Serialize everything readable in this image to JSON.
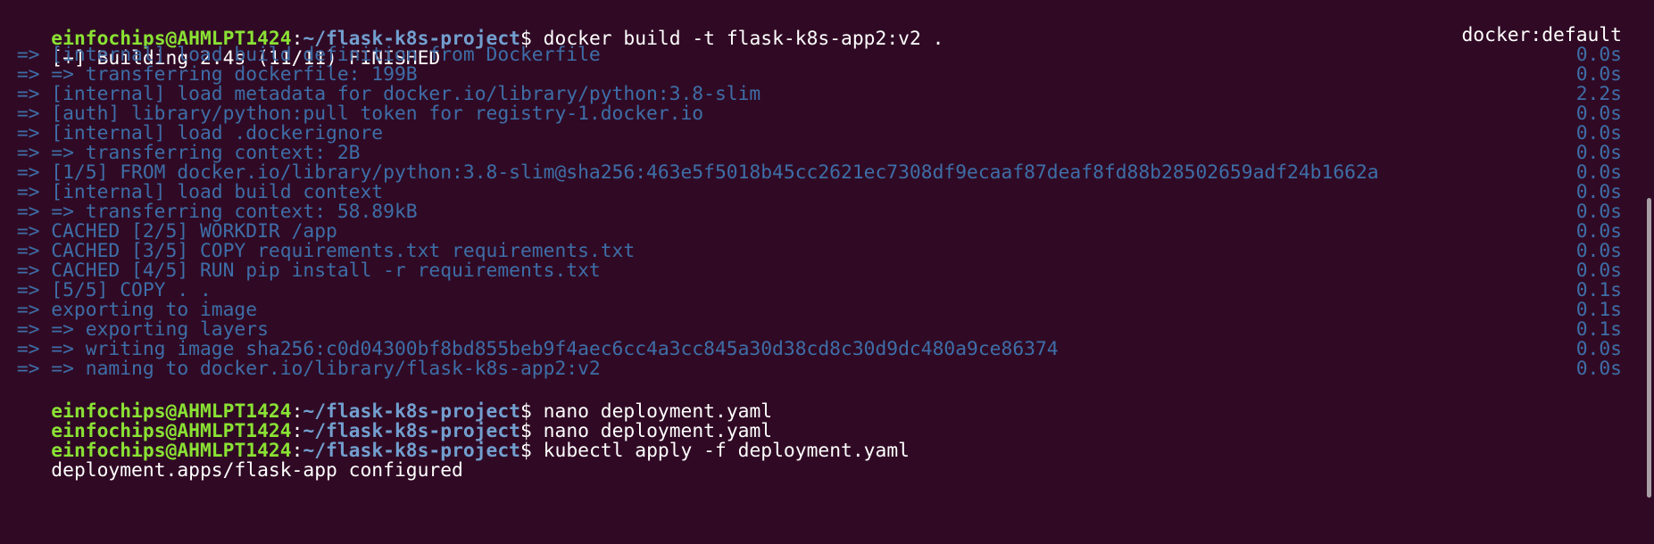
{
  "prompt": {
    "user": "einfochips@AHMLPT1424",
    "colon": ":",
    "path": "~/flask-k8s-project",
    "dollar": "$"
  },
  "commands": {
    "build": "docker build -t flask-k8s-app2:v2 .",
    "nano1": "nano deployment.yaml",
    "nano2": "nano deployment.yaml",
    "apply": "kubectl apply -f deployment.yaml"
  },
  "build_header": {
    "text": "[+] Building 2.4s (11/11) FINISHED",
    "context": "docker:default"
  },
  "build_steps": [
    {
      "text": " => [internal] load build definition from Dockerfile",
      "time": "0.0s"
    },
    {
      "text": " => => transferring dockerfile: 199B",
      "time": "0.0s"
    },
    {
      "text": " => [internal] load metadata for docker.io/library/python:3.8-slim",
      "time": "2.2s"
    },
    {
      "text": " => [auth] library/python:pull token for registry-1.docker.io",
      "time": "0.0s"
    },
    {
      "text": " => [internal] load .dockerignore",
      "time": "0.0s"
    },
    {
      "text": " => => transferring context: 2B",
      "time": "0.0s"
    },
    {
      "text": " => [1/5] FROM docker.io/library/python:3.8-slim@sha256:463e5f5018b45cc2621ec7308df9ecaaf87deaf8fd88b28502659adf24b1662a",
      "time": "0.0s"
    },
    {
      "text": " => [internal] load build context",
      "time": "0.0s"
    },
    {
      "text": " => => transferring context: 58.89kB",
      "time": "0.0s"
    },
    {
      "text": " => CACHED [2/5] WORKDIR /app",
      "time": "0.0s"
    },
    {
      "text": " => CACHED [3/5] COPY requirements.txt requirements.txt",
      "time": "0.0s"
    },
    {
      "text": " => CACHED [4/5] RUN pip install -r requirements.txt",
      "time": "0.0s"
    },
    {
      "text": " => [5/5] COPY . .",
      "time": "0.1s"
    },
    {
      "text": " => exporting to image",
      "time": "0.1s"
    },
    {
      "text": " => => exporting layers",
      "time": "0.1s"
    },
    {
      "text": " => => writing image sha256:c0d04300bf8bd855beb9f4aec6cc4a3cc845a30d38cd8c30d9dc480a9ce86374",
      "time": "0.0s"
    },
    {
      "text": " => => naming to docker.io/library/flask-k8s-app2:v2",
      "time": "0.0s"
    }
  ],
  "output": {
    "apply_result": "deployment.apps/flask-app configured"
  },
  "colors": {
    "background": "#300a24",
    "user": "#8ae234",
    "path": "#729fcf",
    "step": "#3e6ea8"
  }
}
